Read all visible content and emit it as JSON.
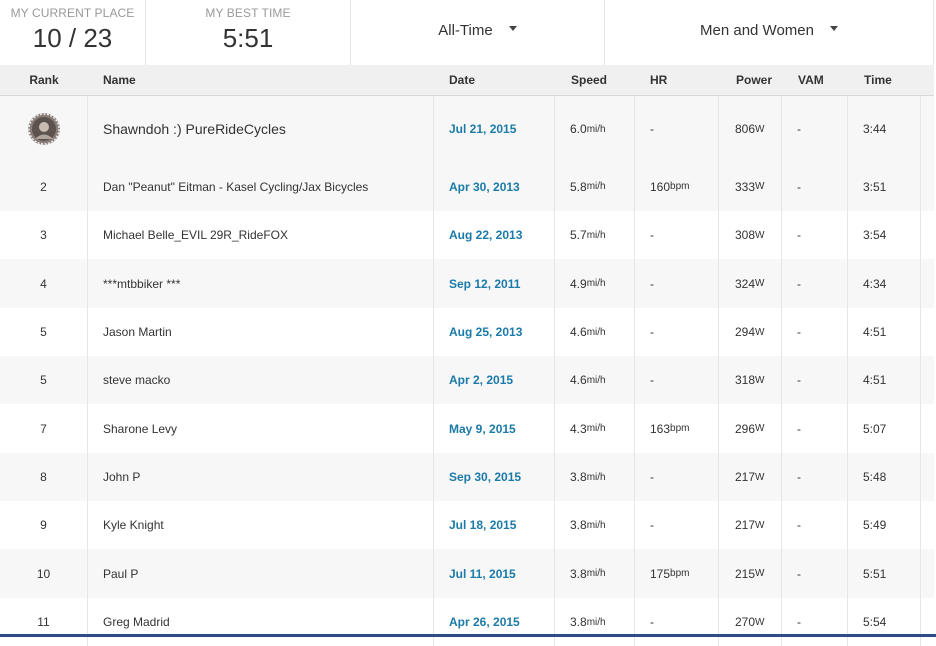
{
  "stats": {
    "current_place_label": "MY CURRENT PLACE",
    "current_place_value": "10 / 23",
    "best_time_label": "MY BEST TIME",
    "best_time_value": "5:51"
  },
  "filters": {
    "time_range": "All-Time",
    "gender": "Men and Women"
  },
  "table": {
    "columns": [
      "Rank",
      "Name",
      "Date",
      "Speed",
      "HR",
      "Power",
      "VAM",
      "Time"
    ],
    "rows": [
      {
        "rank": "",
        "name": "Shawndoh :) PureRideCycles",
        "date": "Jul 21, 2015",
        "speed": "6.0",
        "speed_unit": "mi/h",
        "hr": "-",
        "hr_unit": "",
        "power": "806",
        "power_unit": "W",
        "vam": "-",
        "time": "3:44"
      },
      {
        "rank": "2",
        "name": "Dan \"Peanut\" Eitman - Kasel Cycling/Jax Bicycles",
        "date": "Apr 30, 2013",
        "speed": "5.8",
        "speed_unit": "mi/h",
        "hr": "160",
        "hr_unit": "bpm",
        "power": "333",
        "power_unit": "W",
        "vam": "-",
        "time": "3:51"
      },
      {
        "rank": "3",
        "name": "Michael Belle_EVIL 29R_RideFOX",
        "date": "Aug 22, 2013",
        "speed": "5.7",
        "speed_unit": "mi/h",
        "hr": "-",
        "hr_unit": "",
        "power": "308",
        "power_unit": "W",
        "vam": "-",
        "time": "3:54"
      },
      {
        "rank": "4",
        "name": "***mtbbiker ***",
        "date": "Sep 12, 2011",
        "speed": "4.9",
        "speed_unit": "mi/h",
        "hr": "-",
        "hr_unit": "",
        "power": "324",
        "power_unit": "W",
        "vam": "-",
        "time": "4:34"
      },
      {
        "rank": "5",
        "name": "Jason Martin",
        "date": "Aug 25, 2013",
        "speed": "4.6",
        "speed_unit": "mi/h",
        "hr": "-",
        "hr_unit": "",
        "power": "294",
        "power_unit": "W",
        "vam": "-",
        "time": "4:51"
      },
      {
        "rank": "5",
        "name": "steve macko",
        "date": "Apr 2, 2015",
        "speed": "4.6",
        "speed_unit": "mi/h",
        "hr": "-",
        "hr_unit": "",
        "power": "318",
        "power_unit": "W",
        "vam": "-",
        "time": "4:51"
      },
      {
        "rank": "7",
        "name": "Sharone Levy",
        "date": "May 9, 2015",
        "speed": "4.3",
        "speed_unit": "mi/h",
        "hr": "163",
        "hr_unit": "bpm",
        "power": "296",
        "power_unit": "W",
        "vam": "-",
        "time": "5:07"
      },
      {
        "rank": "8",
        "name": "John P",
        "date": "Sep 30, 2015",
        "speed": "3.8",
        "speed_unit": "mi/h",
        "hr": "-",
        "hr_unit": "",
        "power": "217",
        "power_unit": "W",
        "vam": "-",
        "time": "5:48"
      },
      {
        "rank": "9",
        "name": "Kyle Knight",
        "date": "Jul 18, 2015",
        "speed": "3.8",
        "speed_unit": "mi/h",
        "hr": "-",
        "hr_unit": "",
        "power": "217",
        "power_unit": "W",
        "vam": "-",
        "time": "5:49"
      },
      {
        "rank": "10",
        "name": "Paul P",
        "date": "Jul 11, 2015",
        "speed": "3.8",
        "speed_unit": "mi/h",
        "hr": "175",
        "hr_unit": "bpm",
        "power": "215",
        "power_unit": "W",
        "vam": "-",
        "time": "5:51"
      },
      {
        "rank": "11",
        "name": "Greg Madrid",
        "date": "Apr 26, 2015",
        "speed": "3.8",
        "speed_unit": "mi/h",
        "hr": "-",
        "hr_unit": "",
        "power": "270",
        "power_unit": "W",
        "vam": "-",
        "time": "5:54"
      }
    ]
  },
  "icons": {
    "filter_caret": "caret-down-icon",
    "rank_one": "avatar"
  },
  "colors": {
    "date_link": "#1a7aa8",
    "header_bg": "#f0f0f0",
    "bottom_bar": "#2d4d84"
  }
}
